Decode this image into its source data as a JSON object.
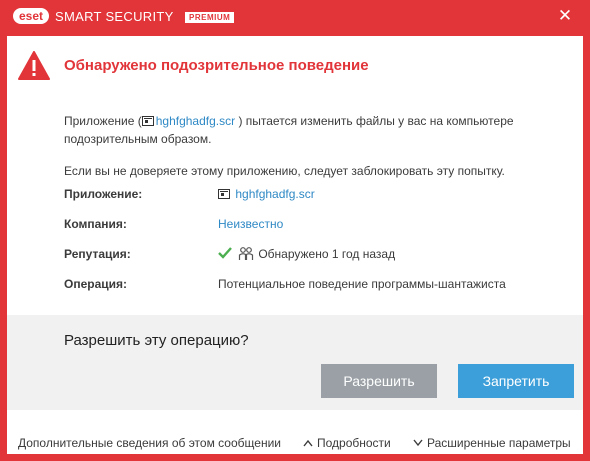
{
  "titlebar": {
    "logo": "eset",
    "product": "SMART SECURITY",
    "edition": "PREMIUM",
    "close_icon": "close-icon"
  },
  "alert": {
    "heading": "Обнаружено подозрительное поведение",
    "icon": "warning-icon",
    "accent_color": "#e1353a"
  },
  "message": {
    "p1_before": "Приложение (",
    "p1_app": "hghfghadfg.scr",
    "p1_after": " ) пытается изменить файлы у вас на компьютере подозрительным образом.",
    "p2": "Если вы не доверяете этому приложению, следует заблокировать эту попытку."
  },
  "details": {
    "application_label": "Приложение:",
    "application_value": "hghfghadfg.scr",
    "company_label": "Компания:",
    "company_value": "Неизвестно",
    "reputation_label": "Репутация:",
    "reputation_value": "Обнаружено 1 год назад",
    "operation_label": "Операция:",
    "operation_value": "Потенциальное поведение программы-шантажиста"
  },
  "prompt": {
    "question": "Разрешить эту операцию?",
    "allow_label": "Разрешить",
    "deny_label": "Запретить"
  },
  "footer": {
    "more_info": "Дополнительные сведения об этом сообщении",
    "details": "Подробности",
    "advanced": "Расширенные параметры"
  }
}
